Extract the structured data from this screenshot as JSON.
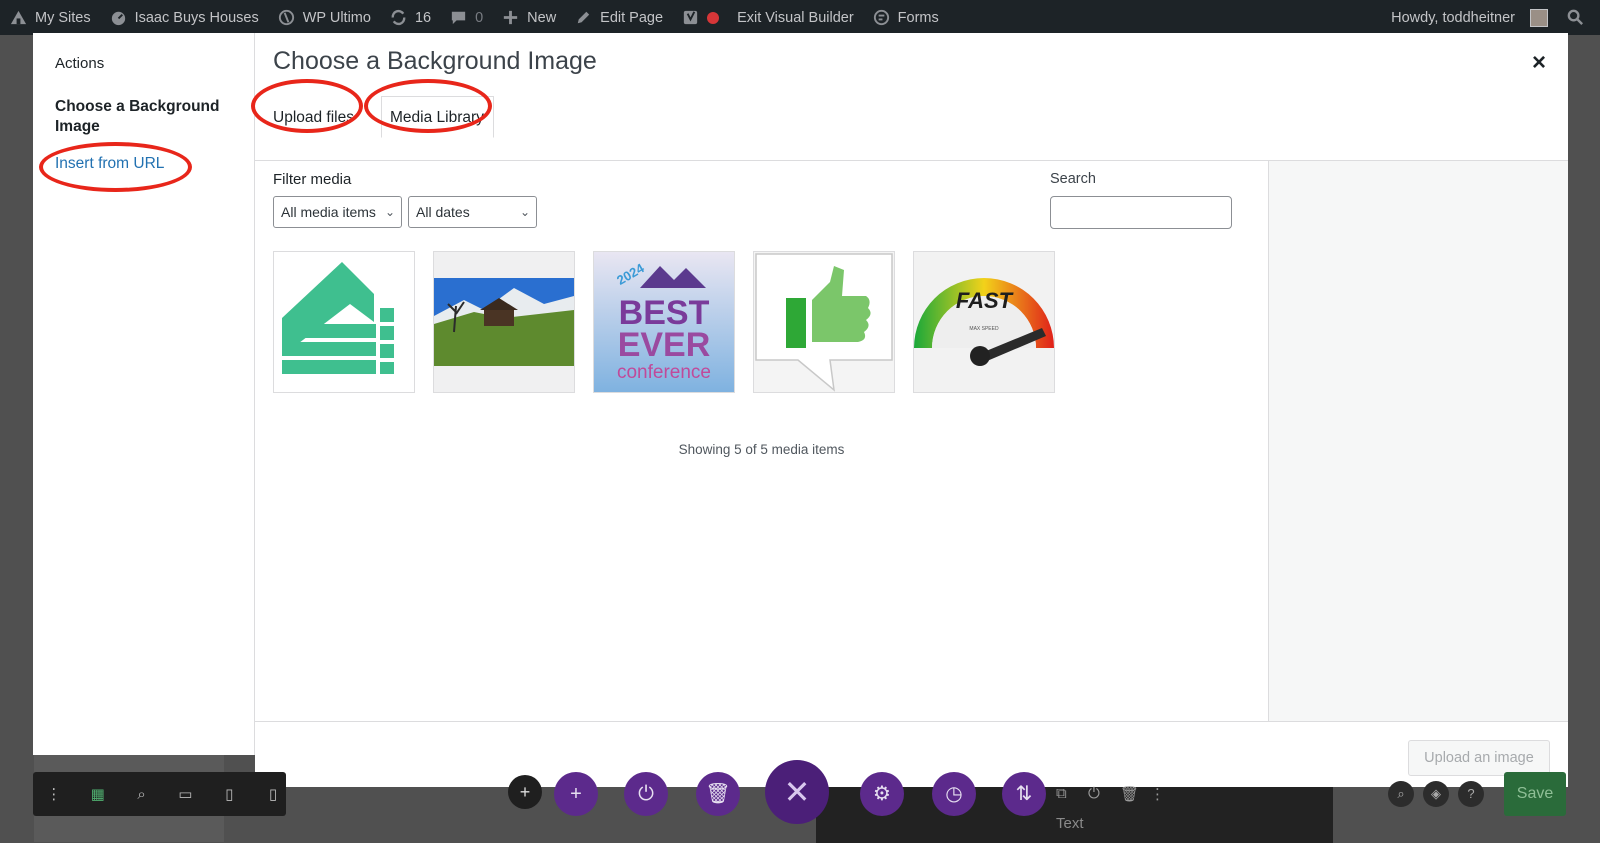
{
  "adminbar": {
    "my_sites": "My Sites",
    "site_name": "Isaac Buys Houses",
    "wp_ultimo": "WP Ultimo",
    "updates_count": "16",
    "comments_count": "0",
    "new": "New",
    "edit_page": "Edit Page",
    "exit_builder": "Exit Visual Builder",
    "forms": "Forms",
    "howdy": "Howdy, toddheitner"
  },
  "modal": {
    "menu": {
      "heading": "Actions",
      "active_item": "Choose a Background Image",
      "insert_url": "Insert from URL"
    },
    "title": "Choose a Background Image",
    "close": "×",
    "tabs": {
      "upload": "Upload files",
      "library": "Media Library"
    },
    "filter": {
      "label": "Filter media",
      "media_type": "All media items",
      "dates": "All dates"
    },
    "search": {
      "label": "Search",
      "value": ""
    },
    "thumbnails": [
      {
        "name": "green-building-logo",
        "thumb_text": ""
      },
      {
        "name": "mountain-cabin-photo",
        "thumb_text": ""
      },
      {
        "name": "best-ever-conference",
        "thumb_text_year": "2024",
        "thumb_text_1": "BEST",
        "thumb_text_2": "EVER",
        "thumb_text_3": "conference"
      },
      {
        "name": "thumbs-up-bubble",
        "thumb_text": ""
      },
      {
        "name": "fast-speedometer",
        "thumb_text_1": "FAST",
        "thumb_text_2": "MAX SPEED"
      }
    ],
    "showing": "Showing 5 of 5 media items",
    "upload_button": "Upload an image"
  },
  "builder": {
    "text_label": "Text",
    "save": "Save"
  },
  "colors": {
    "annotation": "#e8261a",
    "link": "#2271b1",
    "builder_purple": "#5c2a8c",
    "save_green": "#2a6b3a"
  }
}
